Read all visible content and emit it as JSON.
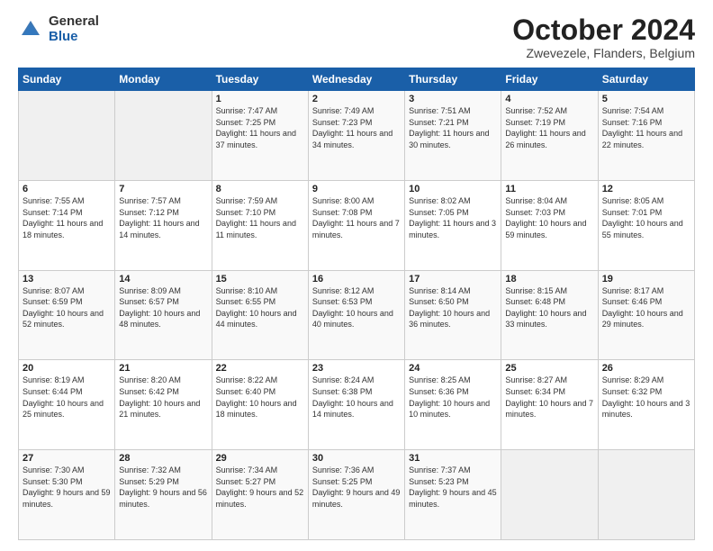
{
  "header": {
    "logo_general": "General",
    "logo_blue": "Blue",
    "title": "October 2024",
    "subtitle": "Zwevezele, Flanders, Belgium"
  },
  "days_of_week": [
    "Sunday",
    "Monday",
    "Tuesday",
    "Wednesday",
    "Thursday",
    "Friday",
    "Saturday"
  ],
  "weeks": [
    [
      {
        "num": "",
        "info": ""
      },
      {
        "num": "",
        "info": ""
      },
      {
        "num": "1",
        "info": "Sunrise: 7:47 AM\nSunset: 7:25 PM\nDaylight: 11 hours and 37 minutes."
      },
      {
        "num": "2",
        "info": "Sunrise: 7:49 AM\nSunset: 7:23 PM\nDaylight: 11 hours and 34 minutes."
      },
      {
        "num": "3",
        "info": "Sunrise: 7:51 AM\nSunset: 7:21 PM\nDaylight: 11 hours and 30 minutes."
      },
      {
        "num": "4",
        "info": "Sunrise: 7:52 AM\nSunset: 7:19 PM\nDaylight: 11 hours and 26 minutes."
      },
      {
        "num": "5",
        "info": "Sunrise: 7:54 AM\nSunset: 7:16 PM\nDaylight: 11 hours and 22 minutes."
      }
    ],
    [
      {
        "num": "6",
        "info": "Sunrise: 7:55 AM\nSunset: 7:14 PM\nDaylight: 11 hours and 18 minutes."
      },
      {
        "num": "7",
        "info": "Sunrise: 7:57 AM\nSunset: 7:12 PM\nDaylight: 11 hours and 14 minutes."
      },
      {
        "num": "8",
        "info": "Sunrise: 7:59 AM\nSunset: 7:10 PM\nDaylight: 11 hours and 11 minutes."
      },
      {
        "num": "9",
        "info": "Sunrise: 8:00 AM\nSunset: 7:08 PM\nDaylight: 11 hours and 7 minutes."
      },
      {
        "num": "10",
        "info": "Sunrise: 8:02 AM\nSunset: 7:05 PM\nDaylight: 11 hours and 3 minutes."
      },
      {
        "num": "11",
        "info": "Sunrise: 8:04 AM\nSunset: 7:03 PM\nDaylight: 10 hours and 59 minutes."
      },
      {
        "num": "12",
        "info": "Sunrise: 8:05 AM\nSunset: 7:01 PM\nDaylight: 10 hours and 55 minutes."
      }
    ],
    [
      {
        "num": "13",
        "info": "Sunrise: 8:07 AM\nSunset: 6:59 PM\nDaylight: 10 hours and 52 minutes."
      },
      {
        "num": "14",
        "info": "Sunrise: 8:09 AM\nSunset: 6:57 PM\nDaylight: 10 hours and 48 minutes."
      },
      {
        "num": "15",
        "info": "Sunrise: 8:10 AM\nSunset: 6:55 PM\nDaylight: 10 hours and 44 minutes."
      },
      {
        "num": "16",
        "info": "Sunrise: 8:12 AM\nSunset: 6:53 PM\nDaylight: 10 hours and 40 minutes."
      },
      {
        "num": "17",
        "info": "Sunrise: 8:14 AM\nSunset: 6:50 PM\nDaylight: 10 hours and 36 minutes."
      },
      {
        "num": "18",
        "info": "Sunrise: 8:15 AM\nSunset: 6:48 PM\nDaylight: 10 hours and 33 minutes."
      },
      {
        "num": "19",
        "info": "Sunrise: 8:17 AM\nSunset: 6:46 PM\nDaylight: 10 hours and 29 minutes."
      }
    ],
    [
      {
        "num": "20",
        "info": "Sunrise: 8:19 AM\nSunset: 6:44 PM\nDaylight: 10 hours and 25 minutes."
      },
      {
        "num": "21",
        "info": "Sunrise: 8:20 AM\nSunset: 6:42 PM\nDaylight: 10 hours and 21 minutes."
      },
      {
        "num": "22",
        "info": "Sunrise: 8:22 AM\nSunset: 6:40 PM\nDaylight: 10 hours and 18 minutes."
      },
      {
        "num": "23",
        "info": "Sunrise: 8:24 AM\nSunset: 6:38 PM\nDaylight: 10 hours and 14 minutes."
      },
      {
        "num": "24",
        "info": "Sunrise: 8:25 AM\nSunset: 6:36 PM\nDaylight: 10 hours and 10 minutes."
      },
      {
        "num": "25",
        "info": "Sunrise: 8:27 AM\nSunset: 6:34 PM\nDaylight: 10 hours and 7 minutes."
      },
      {
        "num": "26",
        "info": "Sunrise: 8:29 AM\nSunset: 6:32 PM\nDaylight: 10 hours and 3 minutes."
      }
    ],
    [
      {
        "num": "27",
        "info": "Sunrise: 7:30 AM\nSunset: 5:30 PM\nDaylight: 9 hours and 59 minutes."
      },
      {
        "num": "28",
        "info": "Sunrise: 7:32 AM\nSunset: 5:29 PM\nDaylight: 9 hours and 56 minutes."
      },
      {
        "num": "29",
        "info": "Sunrise: 7:34 AM\nSunset: 5:27 PM\nDaylight: 9 hours and 52 minutes."
      },
      {
        "num": "30",
        "info": "Sunrise: 7:36 AM\nSunset: 5:25 PM\nDaylight: 9 hours and 49 minutes."
      },
      {
        "num": "31",
        "info": "Sunrise: 7:37 AM\nSunset: 5:23 PM\nDaylight: 9 hours and 45 minutes."
      },
      {
        "num": "",
        "info": ""
      },
      {
        "num": "",
        "info": ""
      }
    ]
  ]
}
